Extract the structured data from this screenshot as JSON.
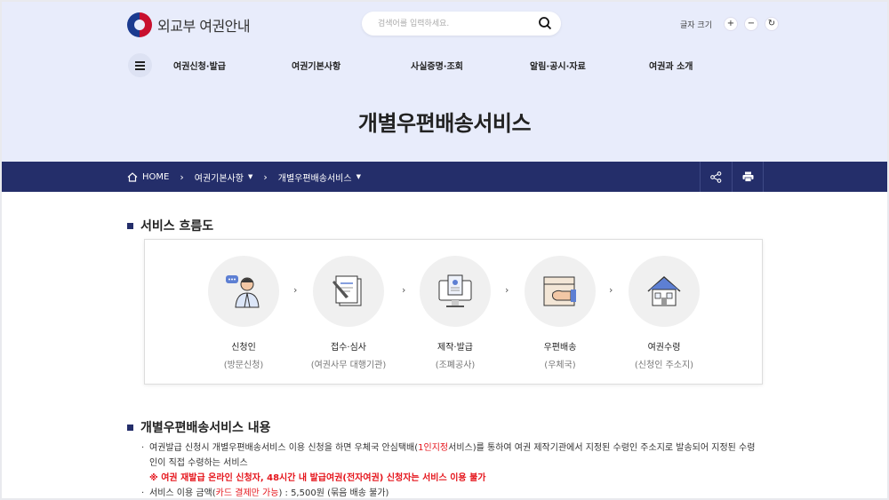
{
  "header": {
    "logo_text": "외교부 여권안내",
    "search_placeholder": "검색어를 입력하세요.",
    "font_size_label": "글자 크기",
    "font_plus": "+",
    "font_minus": "−",
    "font_reset": "↻"
  },
  "nav": {
    "items": [
      "여권신청·발급",
      "여권기본사항",
      "사실증명·조회",
      "알림·공시·자료",
      "여권과 소개"
    ]
  },
  "page_title": "개별우편배송서비스",
  "breadcrumb": {
    "home": "HOME",
    "level1": "여권기본사항",
    "level2": "개별우편배송서비스"
  },
  "flow": {
    "title": "서비스 흐름도",
    "steps": [
      {
        "label": "신청인",
        "sub": "(방문신청)",
        "icon": "person-icon"
      },
      {
        "label": "접수·심사",
        "sub": "(여권사무 대행기관)",
        "icon": "document-review-icon"
      },
      {
        "label": "제작·발급",
        "sub": "(조폐공사)",
        "icon": "production-icon"
      },
      {
        "label": "우편배송",
        "sub": "(우체국)",
        "icon": "delivery-box-icon"
      },
      {
        "label": "여권수령",
        "sub": "(신청인 주소지)",
        "icon": "house-icon"
      }
    ]
  },
  "content": {
    "title": "개별우편배송서비스 내용",
    "item1_a": "여권발급 신청시 개별우편배송서비스 이용 신청을 하면 우체국 안심택배(",
    "item1_red": "1인지정",
    "item1_b": "서비스)를 통하여 여권 제작기관에서 지정된 수령인 주소지로 발송되어 지정된 수령인이 직접 수령하는 서비스",
    "warning": "※ 여권 재발급 온라인 신청자, 48시간 내 발급여권(전자여권) 신청자는 서비스 이용 불가",
    "item2_a": "서비스 이용 금액(",
    "item2_red": "카드 결제만 가능",
    "item2_b": ") : 5,500원 (묶음 배송 불가)"
  },
  "colors": {
    "header_bg": "#e8ecfb",
    "breadcrumb_bg": "#242e6a",
    "warning": "#e5141b"
  }
}
